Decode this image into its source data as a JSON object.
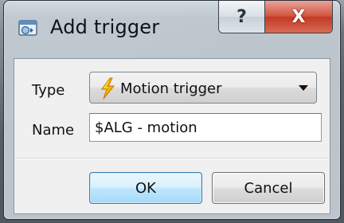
{
  "window": {
    "title": "Add trigger",
    "app_icon": "add-trigger-app-icon",
    "help_label": "?",
    "close_label": "X"
  },
  "form": {
    "type_label": "Type",
    "type_value": "Motion trigger",
    "type_icon": "lightning-bolt-icon",
    "name_label": "Name",
    "name_value": "$ALG - motion"
  },
  "buttons": {
    "ok_label": "OK",
    "cancel_label": "Cancel"
  },
  "colors": {
    "close_button": "#c13a26",
    "ok_border": "#3c7fb1",
    "bolt": "#f0a800"
  }
}
